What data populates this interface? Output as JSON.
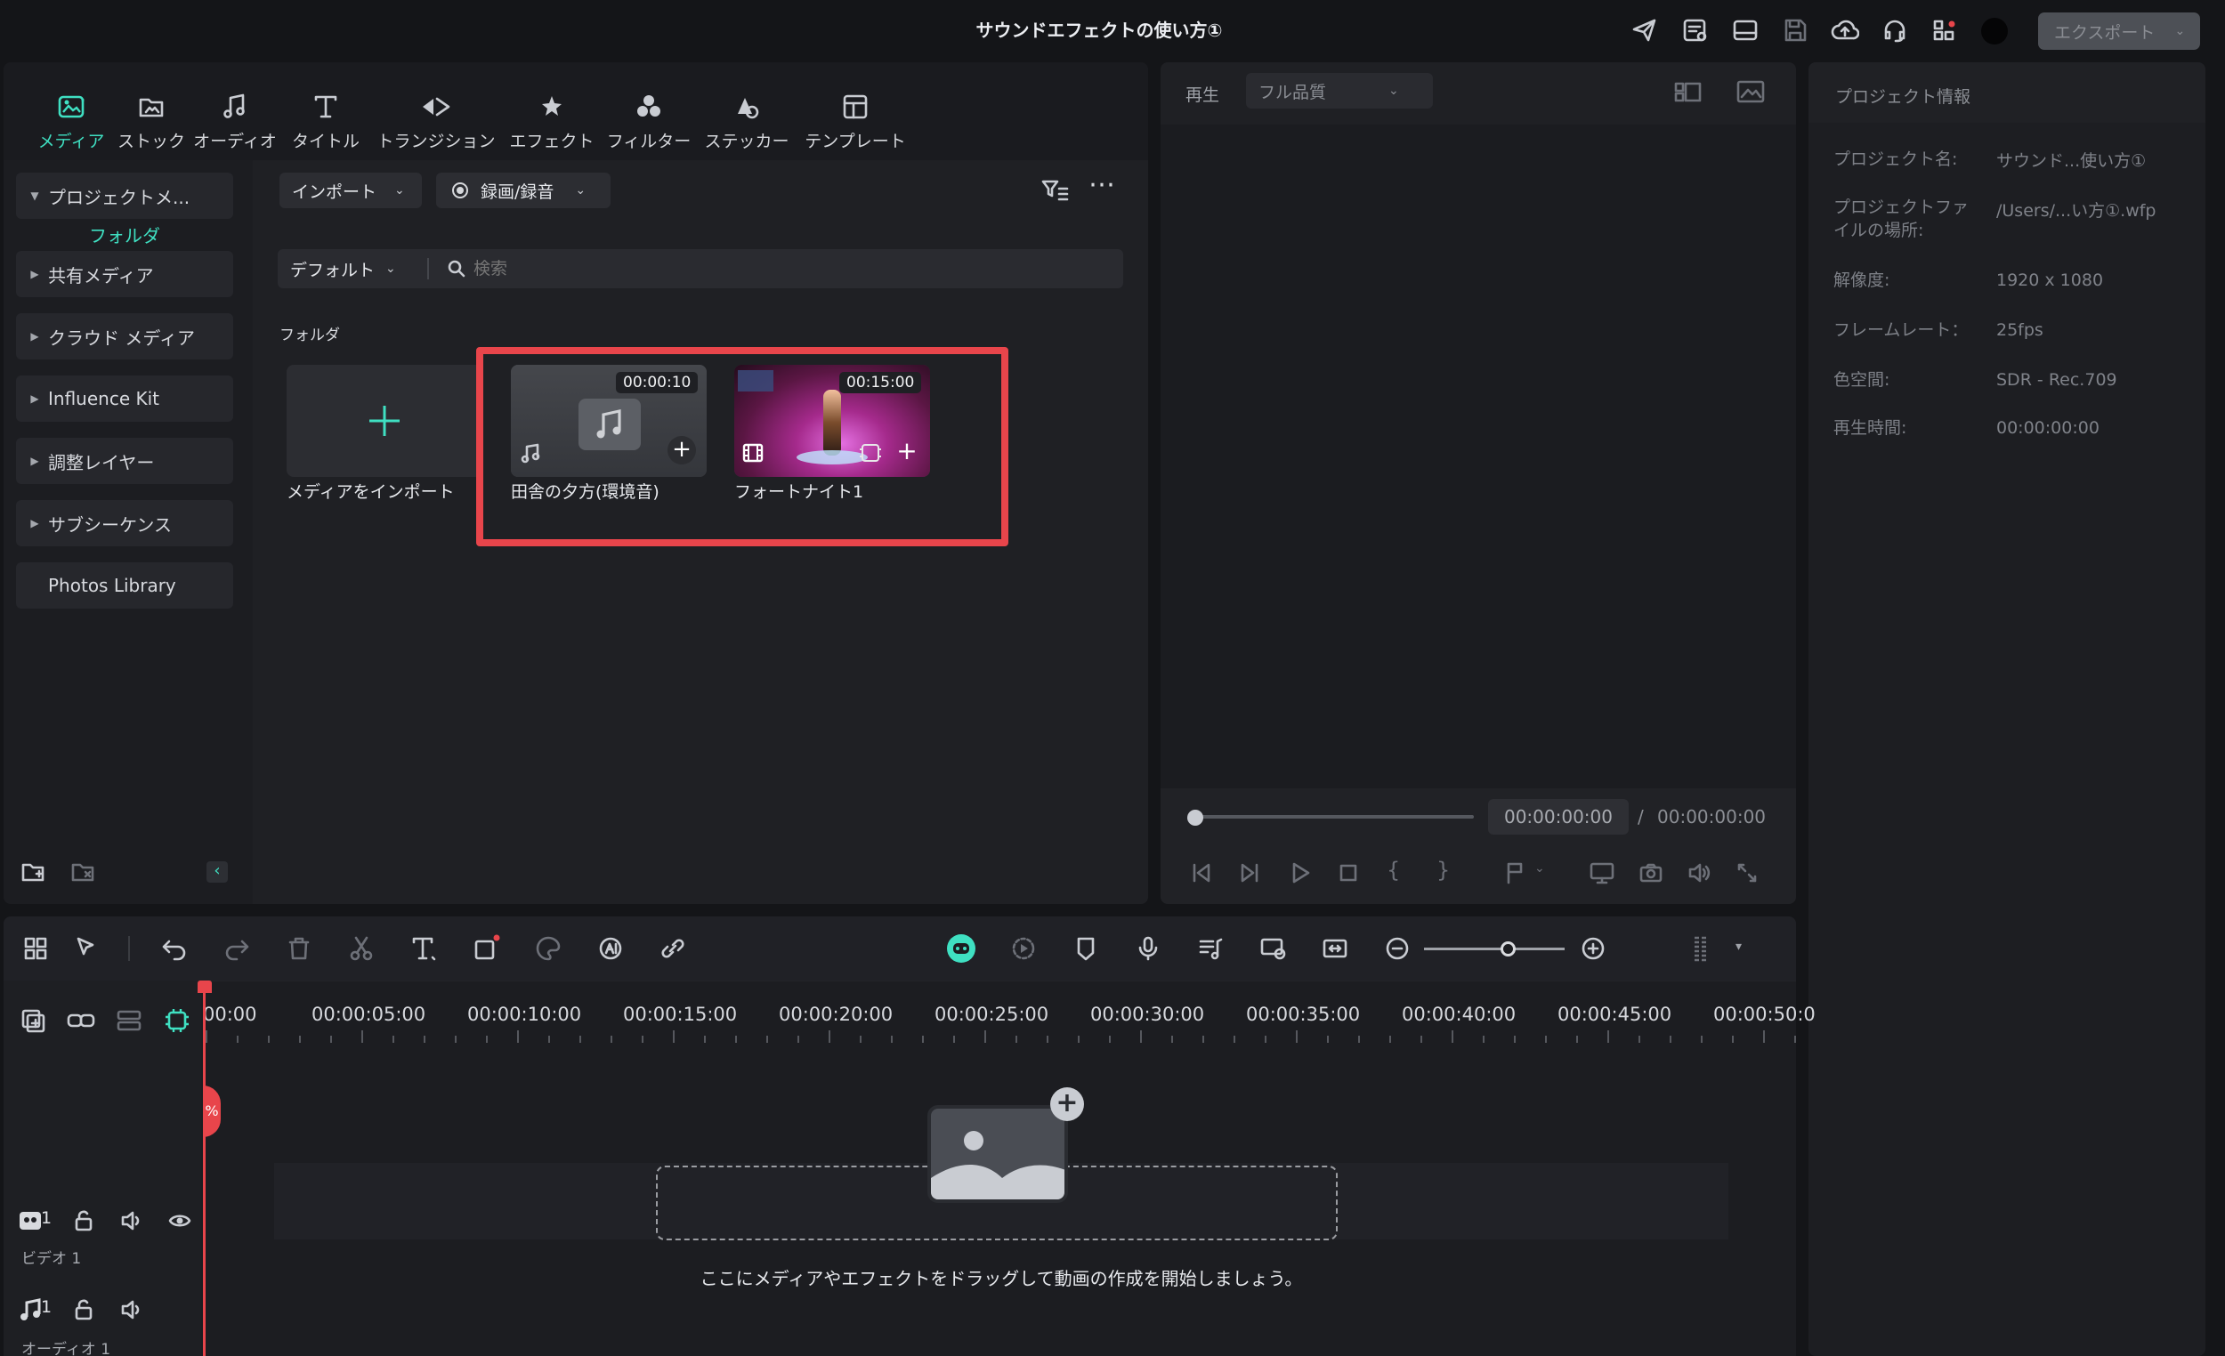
{
  "window": {
    "title": "サウンドエフェクトの使い方①",
    "export_label": "エクスポート"
  },
  "tabs": [
    {
      "label": "メディア",
      "icon": "media-icon",
      "active": true
    },
    {
      "label": "ストック",
      "icon": "stock-icon"
    },
    {
      "label": "オーディオ",
      "icon": "music-note-icon"
    },
    {
      "label": "タイトル",
      "icon": "text-t-icon"
    },
    {
      "label": "トランジション",
      "icon": "transition-icon"
    },
    {
      "label": "エフェクト",
      "icon": "effect-star-icon"
    },
    {
      "label": "フィルター",
      "icon": "filter-circles-icon"
    },
    {
      "label": "ステッカー",
      "icon": "sticker-icon"
    },
    {
      "label": "テンプレート",
      "icon": "template-icon"
    }
  ],
  "sidebar": {
    "project_media": "プロジェクトメ...",
    "folder": "フォルダ",
    "items": [
      "共有メディア",
      "クラウド メディア",
      "Influence Kit",
      "調整レイヤー",
      "サブシーケンス",
      "Photos Library"
    ]
  },
  "media": {
    "import_label": "インポート",
    "record_label": "録画/録音",
    "sort_label": "デフォルト",
    "search_placeholder": "検索",
    "section_label": "フォルダ",
    "import_tile_label": "メディアをインポート",
    "items": [
      {
        "name": "田舎の夕方(環境音)",
        "duration": "00:00:10",
        "kind": "audio"
      },
      {
        "name": "フォートナイト1",
        "duration": "00:15:00",
        "kind": "video"
      }
    ]
  },
  "player": {
    "label": "再生",
    "quality": "フル品質",
    "current_time": "00:00:00:00",
    "separator": "/",
    "total_time": "00:00:00:00"
  },
  "info": {
    "title": "プロジェクト情報",
    "rows": [
      {
        "label": "プロジェクト名:",
        "value": "サウンド...使い方①"
      },
      {
        "label": "プロジェクトファイルの場所:",
        "value": "/Users/...い方①.wfp"
      },
      {
        "label": "解像度:",
        "value": "1920 x 1080"
      },
      {
        "label": "フレームレート：",
        "value": "25fps"
      },
      {
        "label": "色空間:",
        "value": "SDR - Rec.709"
      },
      {
        "label": "再生時間:",
        "value": "00:00:00:00"
      }
    ]
  },
  "timeline": {
    "ruler": [
      "00:00",
      "00:00:05:00",
      "00:00:10:00",
      "00:00:15:00",
      "00:00:20:00",
      "00:00:25:00",
      "00:00:30:00",
      "00:00:35:00",
      "00:00:40:00",
      "00:00:45:00",
      "00:00:50:0"
    ],
    "video_track": "ビデオ 1",
    "video_num": "1",
    "audio_track": "オーディオ 1",
    "audio_num": "1",
    "drop_hint": "ここにメディアやエフェクトをドラッグして動画の作成を開始しましょう。"
  },
  "colors": {
    "accent": "#3fe0c2",
    "highlight": "#e8454b",
    "playhead": "#e8454b"
  }
}
